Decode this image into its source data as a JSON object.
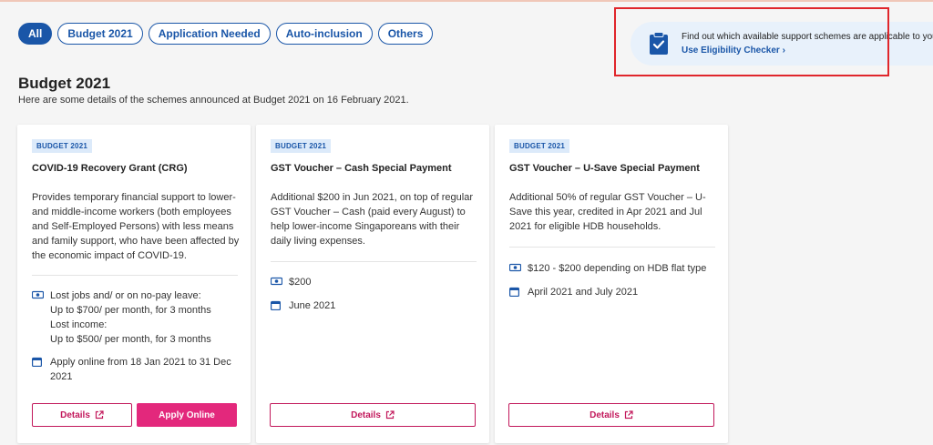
{
  "filters": [
    {
      "label": "All",
      "active": true
    },
    {
      "label": "Budget 2021",
      "active": false
    },
    {
      "label": "Application Needed",
      "active": false
    },
    {
      "label": "Auto-inclusion",
      "active": false
    },
    {
      "label": "Others",
      "active": false
    }
  ],
  "eligibility": {
    "text": "Find out which available support schemes are applicable to you.",
    "link": "Use Eligibility Checker ›"
  },
  "section": {
    "title": "Budget 2021",
    "subtitle": "Here are some details of the schemes announced at Budget 2021 on 16 February 2021."
  },
  "cards": [
    {
      "badge": "BUDGET 2021",
      "title": "COVID-19 Recovery Grant (CRG)",
      "description": "Provides temporary financial support to lower- and middle-income workers (both employees and Self-Employed Persons) with less means and family support, who have been affected by the economic impact of COVID-19.",
      "amount_lines": [
        "Lost jobs and/ or on no-pay leave:",
        "Up to $700/ per month, for 3 months",
        "Lost income:",
        "Up to $500/ per month, for 3 months"
      ],
      "date_lines": [
        "Apply online from 18 Jan 2021 to 31 Dec",
        "2021"
      ],
      "details_label": "Details",
      "apply_label": "Apply Online"
    },
    {
      "badge": "BUDGET 2021",
      "title": "GST Voucher – Cash Special Payment",
      "description": "Additional $200 in Jun 2021, on top of regular GST Voucher – Cash (paid every August) to help lower-income Singaporeans with their daily living expenses.",
      "amount_lines": [
        "$200"
      ],
      "date_lines": [
        "June 2021"
      ],
      "details_label": "Details"
    },
    {
      "badge": "BUDGET 2021",
      "title": "GST Voucher – U-Save Special Payment",
      "description": "Additional 50% of regular GST Voucher – U-Save this year, credited in Apr 2021 and Jul 2021 for eligible HDB households.",
      "amount_lines": [
        "$120 - $200 depending on HDB flat type"
      ],
      "date_lines": [
        "April 2021 and July 2021"
      ],
      "details_label": "Details"
    }
  ],
  "icons": {
    "money": "money-hand-icon",
    "calendar": "calendar-icon",
    "external": "external-link-icon",
    "clipboard": "clipboard-check-icon"
  },
  "colors": {
    "primary_blue": "#1a56a8",
    "accent_pink": "#e3287c",
    "highlight_red": "#e0262b",
    "badge_bg": "#dceafa"
  }
}
